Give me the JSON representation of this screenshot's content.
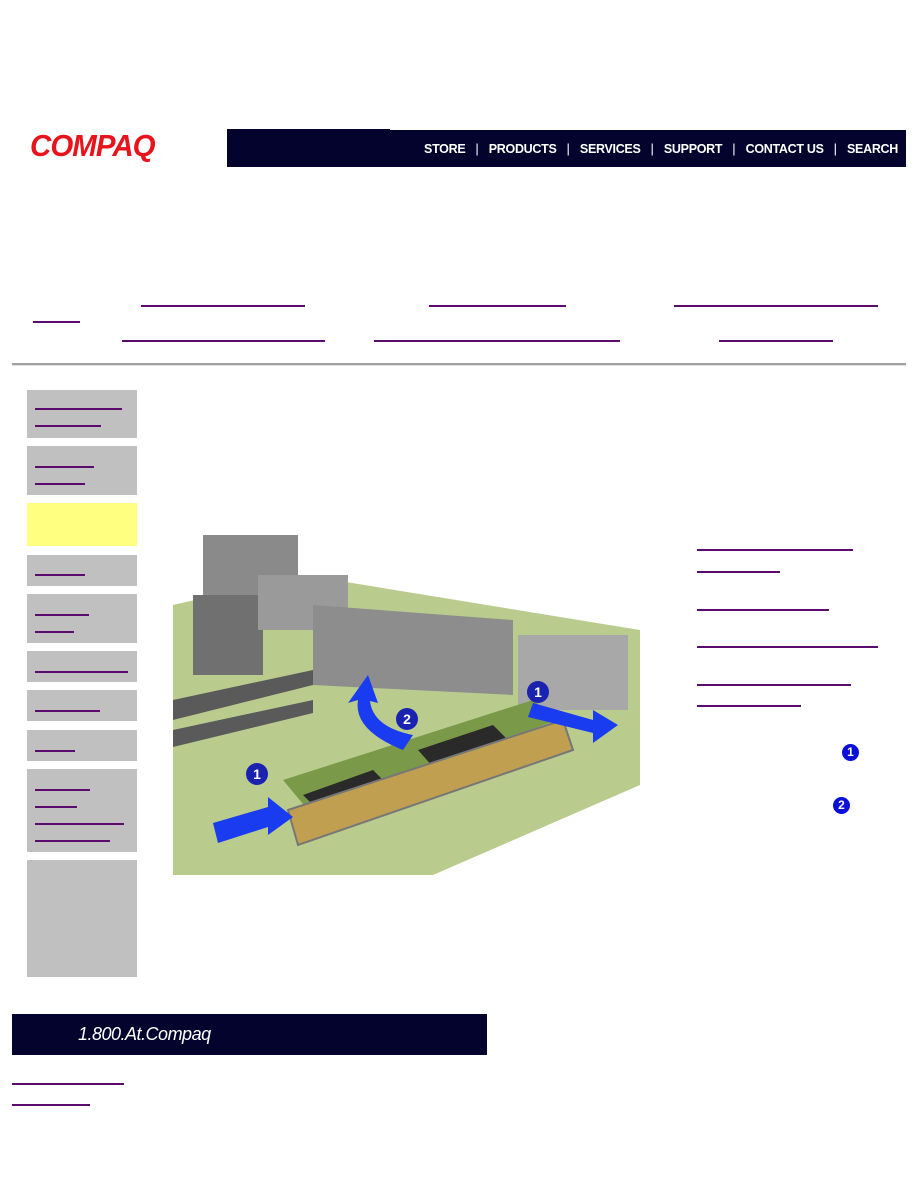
{
  "header": {
    "logo": "COMPAQ",
    "nav": [
      "STORE",
      "PRODUCTS",
      "SERVICES",
      "SUPPORT",
      "CONTACT US",
      "SEARCH"
    ]
  },
  "sidebar": {
    "active_index": 2,
    "active_color": "#ffff80",
    "box_color": "#c0c0c0"
  },
  "callouts": [
    "1",
    "2"
  ],
  "footer": {
    "phone_banner": "1.800.At.Compaq"
  },
  "colors": {
    "nav_bg": "#03032e",
    "link": "#5b0a6e",
    "arrow": "#1a3cf0",
    "logo": "#e8141b"
  }
}
